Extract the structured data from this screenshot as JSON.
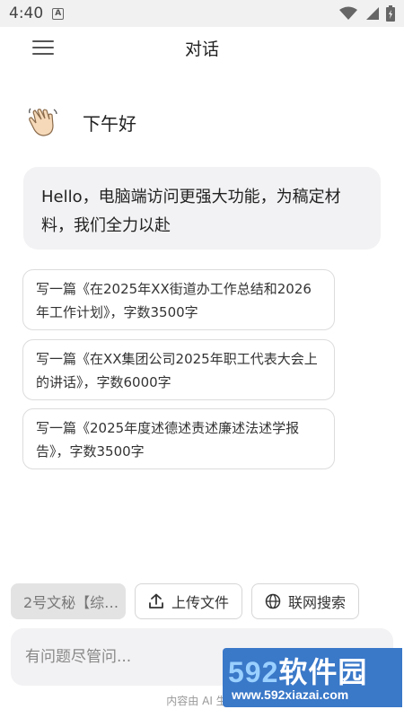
{
  "status_bar": {
    "time": "4:40",
    "notification_letter": "A"
  },
  "header": {
    "title": "对话"
  },
  "greeting": {
    "text": "下午好",
    "icon": "waving-hand-icon"
  },
  "intro": {
    "text": "Hello，电脑端访问更强大功能，为稿定材料，我们全力以赴"
  },
  "suggestions": [
    {
      "text": "写一篇《在2025年XX街道办工作总结和2026年工作计划》，字数3500字"
    },
    {
      "text": "写一篇《在XX集团公司2025年职工代表大会上的讲话》，字数6000字"
    },
    {
      "text": "写一篇《2025年度述德述责述廉述法述学报告》，字数3500字"
    }
  ],
  "toolbar": {
    "model_label": "2号文秘【综…",
    "upload_label": "上传文件",
    "search_label": "联网搜索"
  },
  "input": {
    "placeholder": "有问题尽管问..."
  },
  "footer": {
    "note": "内容由 AI 生成"
  },
  "watermark": {
    "brand_num": "592",
    "brand_text": "软件园",
    "url": "www.592xiazai.com"
  }
}
